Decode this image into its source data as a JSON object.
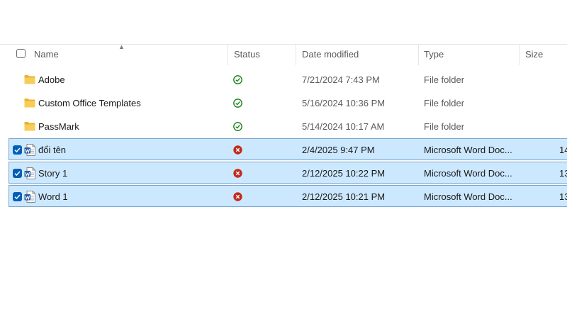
{
  "columns": {
    "name": "Name",
    "status": "Status",
    "date_modified": "Date modified",
    "type": "Type",
    "size": "Size"
  },
  "colors": {
    "selected_bg": "#cce8ff",
    "selected_border": "#7aa7cf",
    "check_blue": "#005fb8",
    "status_ok": "#107c10",
    "status_error": "#c42b1c",
    "folder": "#f2c94c"
  },
  "rows": [
    {
      "name": "Adobe",
      "icon": "folder-icon",
      "status": "synced-icon",
      "date": "7/21/2024 7:43 PM",
      "type": "File folder",
      "size": "",
      "selected": false
    },
    {
      "name": "Custom Office Templates",
      "icon": "folder-icon",
      "status": "synced-icon",
      "date": "5/16/2024 10:36 PM",
      "type": "File folder",
      "size": "",
      "selected": false
    },
    {
      "name": "PassMark",
      "icon": "folder-icon",
      "status": "synced-icon",
      "date": "5/14/2024 10:17 AM",
      "type": "File folder",
      "size": "",
      "selected": false
    },
    {
      "name": "đổi tên",
      "icon": "word-document-icon",
      "status": "sync-error-icon",
      "date": "2/4/2025 9:47 PM",
      "type": "Microsoft Word Doc...",
      "size": "14",
      "selected": true
    },
    {
      "name": "Story 1",
      "icon": "word-document-icon",
      "status": "sync-error-icon",
      "date": "2/12/2025 10:22 PM",
      "type": "Microsoft Word Doc...",
      "size": "13",
      "selected": true
    },
    {
      "name": "Word 1",
      "icon": "word-document-icon",
      "status": "sync-error-icon",
      "date": "2/12/2025 10:21 PM",
      "type": "Microsoft Word Doc...",
      "size": "13",
      "selected": true
    }
  ]
}
